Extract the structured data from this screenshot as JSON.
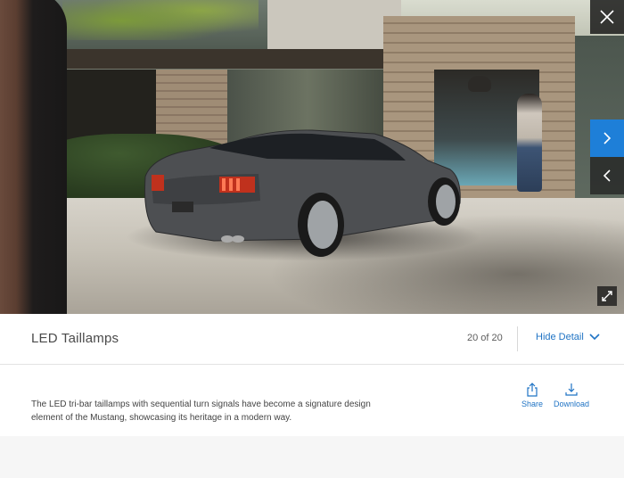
{
  "gallery": {
    "slide_title": "LED Taillamps",
    "counter_text": "20 of 20",
    "hide_detail_label": "Hide Detail",
    "description": "The LED tri-bar taillamps with sequential turn signals have become a signature design element of the Mustang, showcasing its heritage in a modern way.",
    "share_label": "Share",
    "download_label": "Download",
    "icons": {
      "close": "close-icon",
      "next": "chevron-right-icon",
      "prev": "chevron-left-icon",
      "expand": "expand-icon",
      "hide_detail": "chevron-down-icon",
      "share": "share-icon",
      "download": "download-icon"
    },
    "colors": {
      "accent": "#1f73c4",
      "next_button": "#1e7fd8",
      "overlay": "#1e1e1e"
    }
  }
}
